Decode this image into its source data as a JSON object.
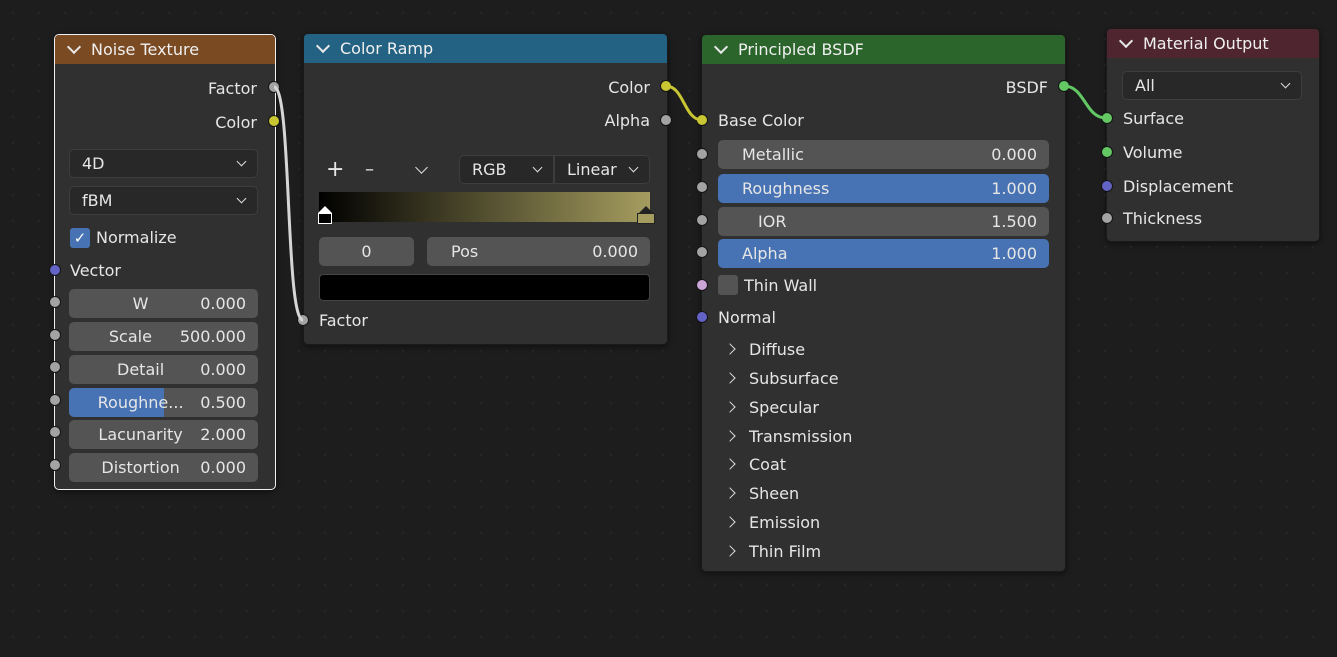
{
  "colors": {
    "noise_header": "#7a4a22",
    "ramp_header": "#246283",
    "bsdf_header": "#2b652b",
    "output_header": "#4f2630",
    "accent": "#4772b3"
  },
  "noise": {
    "title": "Noise Texture",
    "out_factor": "Factor",
    "out_color": "Color",
    "dim": "4D",
    "type": "fBM",
    "normalize": "Normalize",
    "vector": "Vector",
    "fields": [
      {
        "label": "W",
        "value": "0.000"
      },
      {
        "label": "Scale",
        "value": "500.000"
      },
      {
        "label": "Detail",
        "value": "0.000"
      },
      {
        "label": "Roughne...",
        "value": "0.500"
      },
      {
        "label": "Lacunarity",
        "value": "2.000"
      },
      {
        "label": "Distortion",
        "value": "0.000"
      }
    ]
  },
  "ramp": {
    "title": "Color Ramp",
    "out_color": "Color",
    "out_alpha": "Alpha",
    "add": "+",
    "remove": "–",
    "color_mode": "RGB",
    "interpolation": "Linear",
    "index": "0",
    "pos_label": "Pos",
    "pos_value": "0.000",
    "in_factor": "Factor"
  },
  "bsdf": {
    "title": "Principled BSDF",
    "out": "BSDF",
    "base_color": "Base Color",
    "fields": [
      {
        "label": "Metallic",
        "value": "0.000"
      },
      {
        "label": "Roughness",
        "value": "1.000"
      },
      {
        "label": "IOR",
        "value": "1.500"
      },
      {
        "label": "Alpha",
        "value": "1.000"
      }
    ],
    "thin_wall": "Thin Wall",
    "normal": "Normal",
    "panels": [
      "Diffuse",
      "Subsurface",
      "Specular",
      "Transmission",
      "Coat",
      "Sheen",
      "Emission",
      "Thin Film"
    ]
  },
  "output": {
    "title": "Material Output",
    "target": "All",
    "inputs": [
      "Surface",
      "Volume",
      "Displacement",
      "Thickness"
    ]
  }
}
